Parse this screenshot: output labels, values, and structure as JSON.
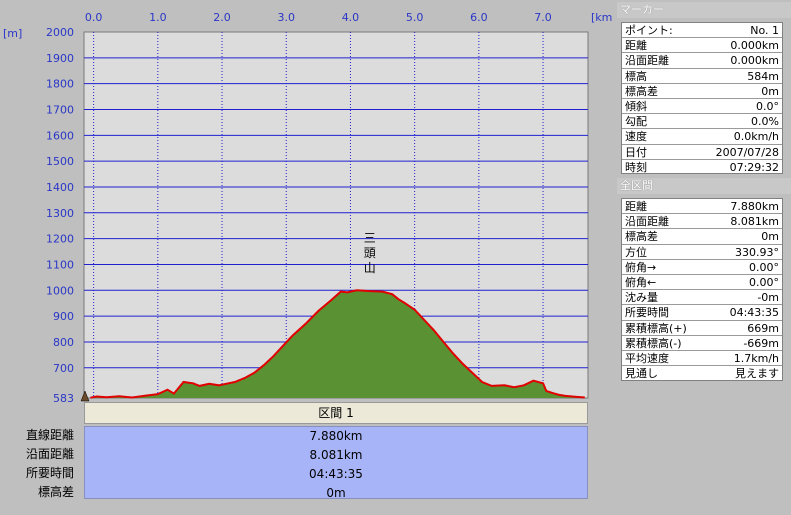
{
  "chart_data": {
    "type": "area",
    "x_unit": "[km]",
    "y_unit": "[m]",
    "xlim": [
      -0.15,
      7.7
    ],
    "ylim": [
      583,
      2000
    ],
    "x_ticks": [
      "0.0",
      "1.0",
      "2.0",
      "3.0",
      "4.0",
      "5.0",
      "6.0",
      "7.0"
    ],
    "x_tick_values": [
      0,
      1,
      2,
      3,
      4,
      5,
      6,
      7
    ],
    "y_ticks": [
      "2000",
      "1900",
      "1800",
      "1700",
      "1600",
      "1500",
      "1400",
      "1300",
      "1200",
      "1100",
      "1000",
      "900",
      "800",
      "700",
      "583"
    ],
    "y_tick_values": [
      2000,
      1900,
      1800,
      1700,
      1600,
      1500,
      1400,
      1300,
      1200,
      1100,
      1000,
      900,
      800,
      700,
      583
    ],
    "grid": true,
    "fill_color": "#5a9132",
    "line_color": "#e00000",
    "plot_background": "#dcdcdc",
    "grid_color": "#2020d0",
    "annotation": {
      "text": [
        "三",
        "頭",
        "山"
      ],
      "x": 4.3
    },
    "series": [
      {
        "x": [
          -0.05,
          0.05,
          0.2,
          0.4,
          0.6,
          0.8,
          1.0,
          1.15,
          1.25,
          1.4,
          1.55,
          1.65,
          1.8,
          1.95,
          2.1,
          2.2,
          2.35,
          2.5,
          2.65,
          2.8,
          2.95,
          3.1,
          3.3,
          3.5,
          3.7,
          3.85,
          3.95,
          4.1,
          4.3,
          4.5,
          4.65,
          4.75,
          4.85,
          5.0,
          5.15,
          5.3,
          5.45,
          5.6,
          5.75,
          5.9,
          6.05,
          6.2,
          6.4,
          6.55,
          6.7,
          6.85,
          7.0,
          7.05,
          7.15,
          7.25,
          7.35,
          7.5,
          7.65
        ],
        "y": [
          584,
          589,
          586,
          590,
          585,
          592,
          598,
          615,
          600,
          645,
          640,
          630,
          638,
          632,
          640,
          645,
          660,
          680,
          710,
          745,
          785,
          825,
          870,
          920,
          962,
          995,
          992,
          1000,
          997,
          995,
          985,
          965,
          950,
          925,
          885,
          845,
          800,
          755,
          715,
          680,
          645,
          630,
          632,
          625,
          632,
          650,
          640,
          610,
          602,
          595,
          591,
          588,
          585
        ]
      }
    ]
  },
  "marker_panel": {
    "header": "マーカー",
    "rows": [
      {
        "label": "ポイント:",
        "value": "No. 1"
      },
      {
        "label": "距離",
        "value": "0.000km"
      },
      {
        "label": "沿面距離",
        "value": "0.000km"
      },
      {
        "label": "標高",
        "value": "584m"
      },
      {
        "label": "標高差",
        "value": "0m"
      },
      {
        "label": "傾斜",
        "value": "0.0°"
      },
      {
        "label": "勾配",
        "value": "0.0%"
      },
      {
        "label": "速度",
        "value": "0.0km/h"
      },
      {
        "label": "日付",
        "value": "2007/07/28"
      },
      {
        "label": "時刻",
        "value": "07:29:32"
      }
    ]
  },
  "total_panel": {
    "header": "全区間",
    "rows": [
      {
        "label": "距離",
        "value": "7.880km"
      },
      {
        "label": "沿面距離",
        "value": "8.081km"
      },
      {
        "label": "標高差",
        "value": "0m"
      },
      {
        "label": "方位",
        "value": "330.93°"
      },
      {
        "label": "俯角→",
        "value": "0.00°"
      },
      {
        "label": "俯角←",
        "value": "0.00°"
      },
      {
        "label": "沈み量",
        "value": "-0m"
      },
      {
        "label": "所要時間",
        "value": "04:43:35"
      },
      {
        "label": "累積標高(+)",
        "value": "669m"
      },
      {
        "label": "累積標高(-)",
        "value": "-669m"
      },
      {
        "label": "平均速度",
        "value": "1.7km/h"
      },
      {
        "label": "見通し",
        "value": "見えます"
      }
    ]
  },
  "segment_table": {
    "header": "区間 1",
    "labels": [
      "直線距離",
      "沿面距離",
      "所要時間",
      "標高差"
    ],
    "values": [
      "7.880km",
      "8.081km",
      "04:43:35",
      "0m"
    ]
  }
}
